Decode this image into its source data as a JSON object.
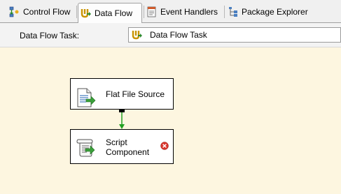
{
  "tabs": [
    {
      "label": "Control Flow",
      "icon": "control-flow-icon",
      "active": false
    },
    {
      "label": "Data Flow",
      "icon": "data-flow-icon",
      "active": true
    },
    {
      "label": "Event Handlers",
      "icon": "event-handlers-icon",
      "active": false
    },
    {
      "label": "Package Explorer",
      "icon": "package-explorer-icon",
      "active": false
    }
  ],
  "toolbar": {
    "task_label": "Data Flow Task:",
    "task_value": "Data Flow Task"
  },
  "components": [
    {
      "label": "Flat File Source",
      "icon": "flat-file-source-icon",
      "has_error": false
    },
    {
      "label": "Script\nComponent",
      "icon": "script-component-icon",
      "has_error": true
    }
  ],
  "colors": {
    "canvas": "#fdf6e0",
    "path_arrow": "#22a022",
    "error": "#d9342b"
  }
}
